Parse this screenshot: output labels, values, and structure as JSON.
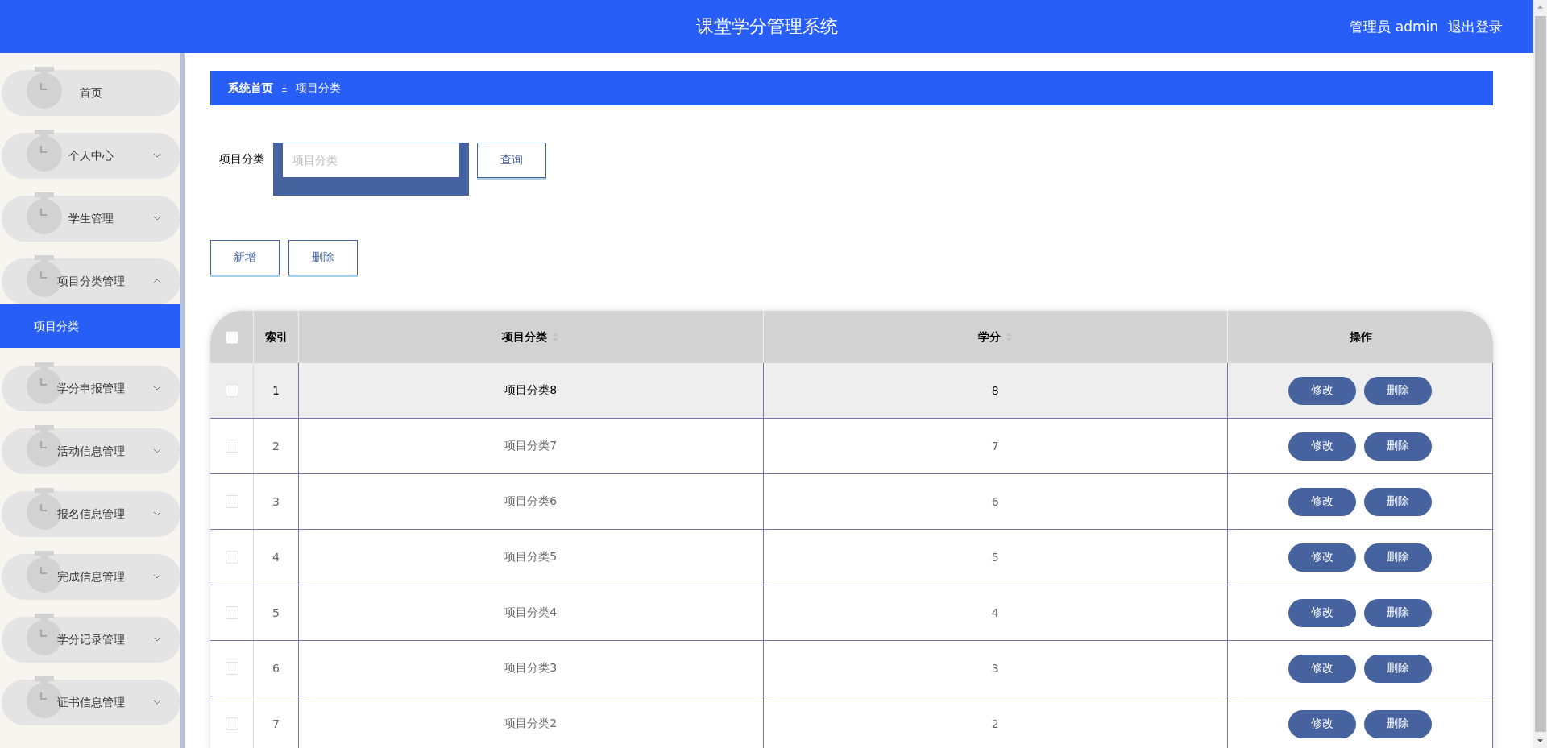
{
  "header": {
    "title": "课堂学分管理系统",
    "user": "管理员 admin",
    "logout": "退出登录"
  },
  "sidebar": {
    "items": [
      {
        "label": "首页",
        "kind": "link"
      },
      {
        "label": "个人中心",
        "kind": "group",
        "expanded": false
      },
      {
        "label": "学生管理",
        "kind": "group",
        "expanded": false
      },
      {
        "label": "项目分类管理",
        "kind": "group",
        "expanded": true,
        "children": [
          {
            "label": "项目分类",
            "selected": true
          }
        ]
      },
      {
        "label": "学分申报管理",
        "kind": "group",
        "expanded": false
      },
      {
        "label": "活动信息管理",
        "kind": "group",
        "expanded": false
      },
      {
        "label": "报名信息管理",
        "kind": "group",
        "expanded": false
      },
      {
        "label": "完成信息管理",
        "kind": "group",
        "expanded": false
      },
      {
        "label": "学分记录管理",
        "kind": "group",
        "expanded": false
      },
      {
        "label": "证书信息管理",
        "kind": "group",
        "expanded": false
      }
    ]
  },
  "breadcrumb": {
    "home": "系统首页",
    "separator": "Ξ",
    "current": "项目分类"
  },
  "search": {
    "label": "项目分类",
    "placeholder": "项目分类",
    "button": "查询"
  },
  "actions": [
    "新增",
    "删除"
  ],
  "table": {
    "columns": [
      {
        "kind": "checkbox",
        "checked": false
      },
      {
        "kind": "text",
        "label": "索引",
        "sortable": false
      },
      {
        "kind": "text",
        "label": "项目分类",
        "sortable": true
      },
      {
        "kind": "text",
        "label": "学分",
        "sortable": true
      },
      {
        "kind": "text",
        "label": "操作",
        "sortable": false
      }
    ],
    "rows": [
      {
        "checked": false,
        "highlighted": true,
        "index": "1",
        "category": "项目分类8",
        "credit": "8",
        "actions": [
          "修改",
          "删除"
        ]
      },
      {
        "checked": false,
        "highlighted": false,
        "index": "2",
        "category": "项目分类7",
        "credit": "7",
        "actions": [
          "修改",
          "删除"
        ]
      },
      {
        "checked": false,
        "highlighted": false,
        "index": "3",
        "category": "项目分类6",
        "credit": "6",
        "actions": [
          "修改",
          "删除"
        ]
      },
      {
        "checked": false,
        "highlighted": false,
        "index": "4",
        "category": "项目分类5",
        "credit": "5",
        "actions": [
          "修改",
          "删除"
        ]
      },
      {
        "checked": false,
        "highlighted": false,
        "index": "5",
        "category": "项目分类4",
        "credit": "4",
        "actions": [
          "修改",
          "删除"
        ]
      },
      {
        "checked": false,
        "highlighted": false,
        "index": "6",
        "category": "项目分类3",
        "credit": "3",
        "actions": [
          "修改",
          "删除"
        ]
      },
      {
        "checked": false,
        "highlighted": false,
        "index": "7",
        "category": "项目分类2",
        "credit": "2",
        "actions": [
          "修改",
          "删除"
        ]
      }
    ]
  }
}
